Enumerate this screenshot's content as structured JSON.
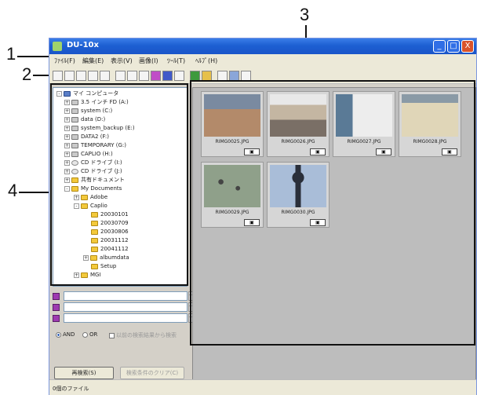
{
  "callouts": [
    "1",
    "2",
    "3",
    "4"
  ],
  "window": {
    "title": "DU-10x",
    "buttons": {
      "minimize": "_",
      "maximize": "□",
      "close": "X"
    }
  },
  "menu": [
    "ﾌｧｲﾙ(F)",
    "編集(E)",
    "表示(V)",
    "画像(I)",
    "ﾂｰﾙ(T)",
    "ﾍﾙﾌﾟ(H)"
  ],
  "tree": [
    {
      "label": "マイ コンピュータ",
      "icon": "computer-icon"
    },
    {
      "label": "3.5 インチ FD (A:)",
      "icon": "floppy-drive-icon"
    },
    {
      "label": "system (C:)",
      "icon": "drive-icon"
    },
    {
      "label": "data (D:)",
      "icon": "drive-icon"
    },
    {
      "label": "system_backup (E:)",
      "icon": "drive-icon"
    },
    {
      "label": "DATA2 (F:)",
      "icon": "drive-icon"
    },
    {
      "label": "TEMPORARY (G:)",
      "icon": "drive-icon"
    },
    {
      "label": "CAPLIO (H:)",
      "icon": "drive-icon"
    },
    {
      "label": "CD ドライブ (I:)",
      "icon": "cd-drive-icon"
    },
    {
      "label": "CD ドライブ (J:)",
      "icon": "cd-drive-icon"
    },
    {
      "label": "共有ドキュメント",
      "icon": "folder-icon"
    },
    {
      "label": "My Documents",
      "icon": "folder-icon"
    },
    {
      "label": "Adobe",
      "icon": "folder-icon"
    },
    {
      "label": "Caplio",
      "icon": "folder-icon"
    },
    {
      "label": "20030101",
      "icon": "folder-icon"
    },
    {
      "label": "20030709",
      "icon": "folder-icon"
    },
    {
      "label": "20030806",
      "icon": "folder-icon"
    },
    {
      "label": "20031112",
      "icon": "folder-icon"
    },
    {
      "label": "20041112",
      "icon": "folder-icon"
    },
    {
      "label": "albumdata",
      "icon": "folder-icon"
    },
    {
      "label": "Setup",
      "icon": "folder-icon"
    },
    {
      "label": "MGI",
      "icon": "folder-icon"
    }
  ],
  "search": {
    "and_label": "AND",
    "or_label": "OR",
    "checkbox_label": "以前の検索結果から検索",
    "search_button": "再検索(S)",
    "clear_button": "検索条件のクリア(C)"
  },
  "thumbnails": [
    {
      "filename": "RIMG0025.JPG",
      "icon": "building-photo"
    },
    {
      "filename": "RIMG0026.JPG",
      "icon": "building-photo"
    },
    {
      "filename": "RIMG0027.JPG",
      "icon": "building-photo"
    },
    {
      "filename": "RIMG0028.JPG",
      "icon": "building-photo"
    },
    {
      "filename": "RIMG0029.JPG",
      "icon": "pigeons-photo"
    },
    {
      "filename": "RIMG0030.JPG",
      "icon": "clock-tower-photo"
    }
  ],
  "status": "0個のファイル"
}
